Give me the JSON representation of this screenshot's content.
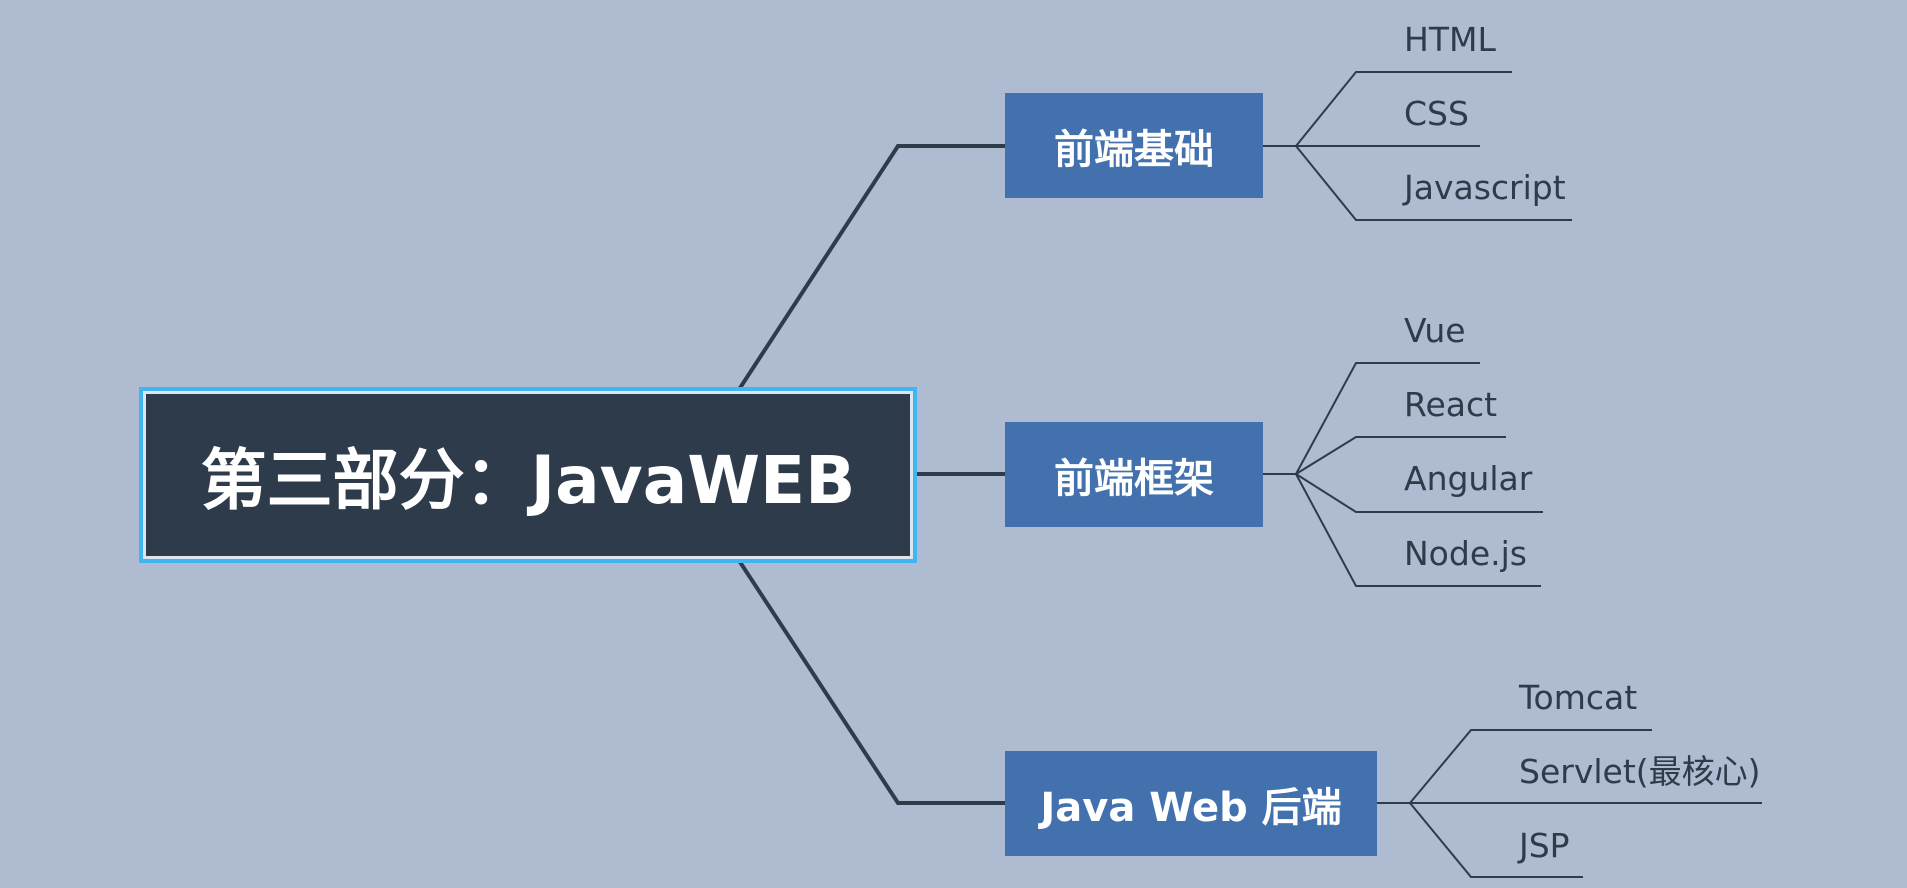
{
  "central": {
    "label": "第三部分：JavaWEB"
  },
  "branches": [
    {
      "label": "前端基础",
      "children": [
        "HTML",
        "CSS",
        "Javascript"
      ]
    },
    {
      "label": "前端框架",
      "children": [
        "Vue",
        "React",
        "Angular",
        "Node.js"
      ]
    },
    {
      "label": "Java Web 后端",
      "children": [
        "Tomcat",
        "Servlet(最核心)",
        "JSP"
      ]
    }
  ],
  "colors": {
    "background": "#aebbd0",
    "central_fill": "#2e3b4b",
    "central_outline": "#3fb6f2",
    "branch_fill": "#4271ae",
    "connector": "#2e3b4b"
  }
}
